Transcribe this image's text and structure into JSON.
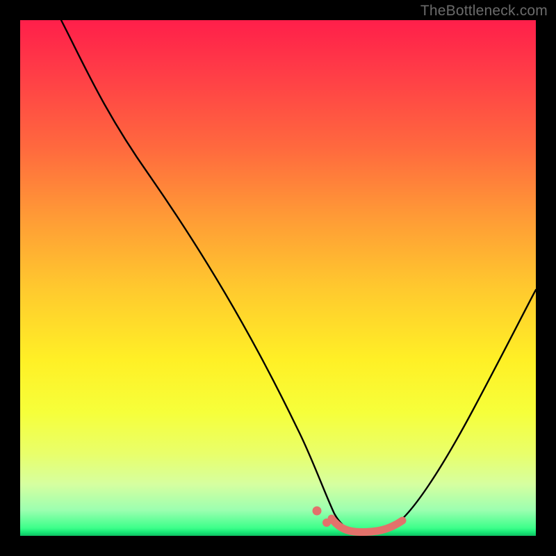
{
  "watermark": "TheBottleneck.com",
  "chart_data": {
    "type": "line",
    "title": "",
    "xlabel": "",
    "ylabel": "",
    "xlim": [
      0,
      100
    ],
    "ylim": [
      0,
      100
    ],
    "grid": false,
    "legend": false,
    "background_gradient": {
      "top": "#ff1f4a",
      "mid": "#fff026",
      "bottom": "#18e876"
    },
    "series": [
      {
        "name": "curve",
        "color": "#000000",
        "x": [
          8,
          15,
          25,
          35,
          45,
          55,
          58,
          62,
          66,
          70,
          74,
          80,
          88,
          96,
          100
        ],
        "y": [
          100,
          88,
          70,
          52,
          34,
          15,
          9,
          3,
          0.7,
          0.5,
          0.7,
          3,
          14,
          30,
          40
        ]
      },
      {
        "name": "highlight",
        "color": "#e3716b",
        "x": [
          58,
          62,
          66,
          70,
          74
        ],
        "y": [
          3.0,
          0.9,
          0.5,
          0.7,
          2.0
        ]
      }
    ],
    "highlight_dots": [
      {
        "x": 57.5,
        "y": 4.0
      },
      {
        "x": 59.5,
        "y": 1.8
      }
    ]
  }
}
